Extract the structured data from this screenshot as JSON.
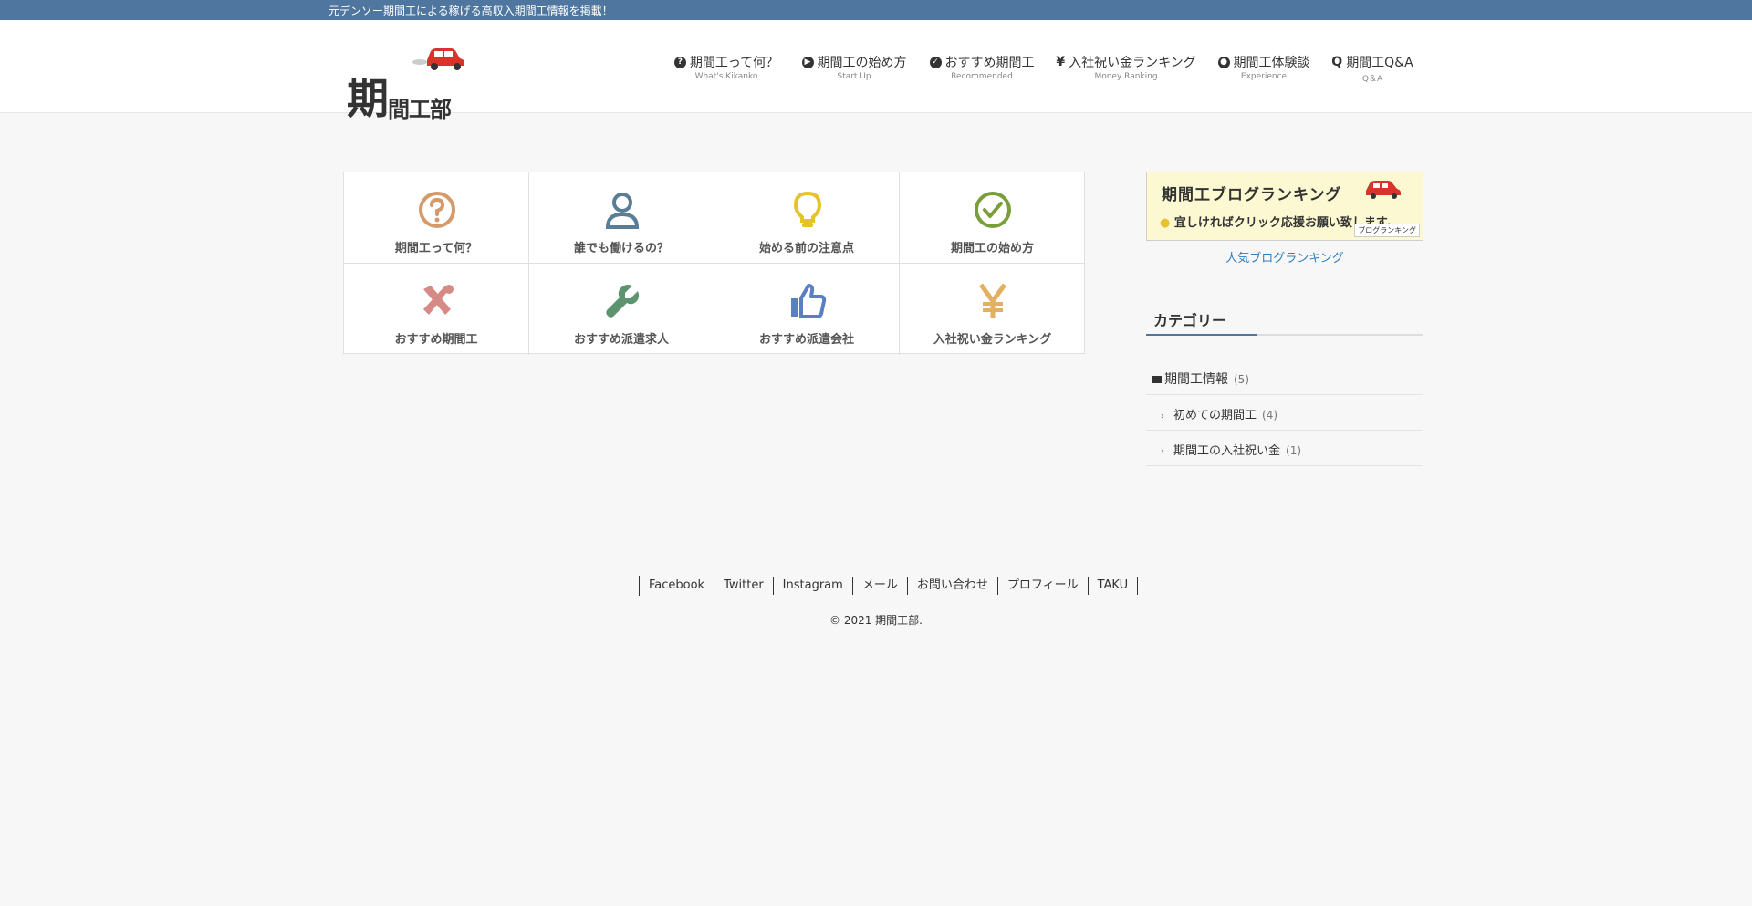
{
  "topbar": {
    "tagline": "元デンソー期間工による稼げる高収入期間工情報を掲載！"
  },
  "logo": {
    "text_big": "期",
    "text_rest": "間工部",
    "alt": "期間工部"
  },
  "nav": [
    {
      "label": "期間工って何？",
      "sub": "What's Kikanko",
      "icon": "question-circle-icon"
    },
    {
      "label": "期間工の始め方",
      "sub": "Start Up",
      "icon": "play-circle-icon"
    },
    {
      "label": "おすすめ期間工",
      "sub": "Recommended",
      "icon": "check-circle-icon"
    },
    {
      "label": "入社祝い金ランキング",
      "sub": "Money Ranking",
      "icon": "yen-icon"
    },
    {
      "label": "期間工体験談",
      "sub": "Experience",
      "icon": "user-circle-icon"
    },
    {
      "label": "期間工Q&A",
      "sub": "Q＆A",
      "icon": "q-icon"
    }
  ],
  "grid": [
    {
      "label": "期間工って何？",
      "icon": "question-circle-icon",
      "color": "#d49a6a"
    },
    {
      "label": "誰でも働けるの？",
      "icon": "user-icon",
      "color": "#5a7d96"
    },
    {
      "label": "始める前の注意点",
      "icon": "lightbulb-icon",
      "color": "#e6c32d"
    },
    {
      "label": "期間工の始め方",
      "icon": "check-circle-icon",
      "color": "#7a9e3a"
    },
    {
      "label": "おすすめ期間工",
      "icon": "tools-icon",
      "color": "#d58a86"
    },
    {
      "label": "おすすめ派遣求人",
      "icon": "wrench-icon",
      "color": "#5d9470"
    },
    {
      "label": "おすすめ派遣会社",
      "icon": "thumbs-up-icon",
      "color": "#5a7fc2"
    },
    {
      "label": "入社祝い金ランキング",
      "icon": "yen-icon",
      "color": "#e3b062"
    }
  ],
  "sidebar": {
    "banner_title": "期間工ブログランキング",
    "banner_sub": "宜しければクリック応援お願い致します。",
    "banner_badge": "ブログランキング",
    "banner_link": "人気ブログランキング",
    "category_title": "カテゴリー",
    "categories": [
      {
        "label": "期間工情報",
        "count": "(5)"
      },
      {
        "label": "初めての期間工",
        "count": "(4)"
      },
      {
        "label": "期間工の入社祝い金",
        "count": "(1)"
      }
    ]
  },
  "footer": {
    "links": [
      "Facebook",
      "Twitter",
      "Instagram",
      "メール",
      "お問い合わせ",
      "プロフィール",
      "TAKU"
    ],
    "copyright": "© 2021 期間工部."
  }
}
